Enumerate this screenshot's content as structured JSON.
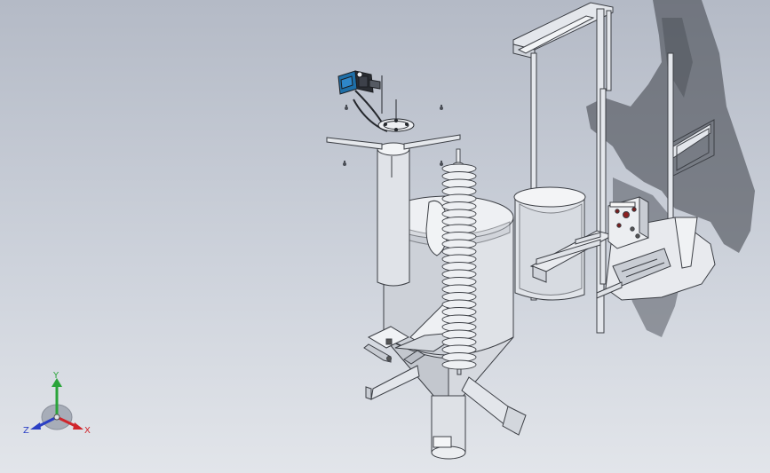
{
  "viewport": {
    "background_top": "#b4bac6",
    "background_bottom": "#e2e5ea"
  },
  "model": {
    "metal_color": "#d9dde4",
    "edge_color": "#3c3f45",
    "shadow_color": "#3a3e46",
    "motor_color": "#1e6fa8"
  },
  "triad": {
    "x_label": "X",
    "y_label": "Y",
    "z_label": "Z",
    "x_color": "#d0262c",
    "y_color": "#2aa43a",
    "z_color": "#2b3fc4"
  }
}
